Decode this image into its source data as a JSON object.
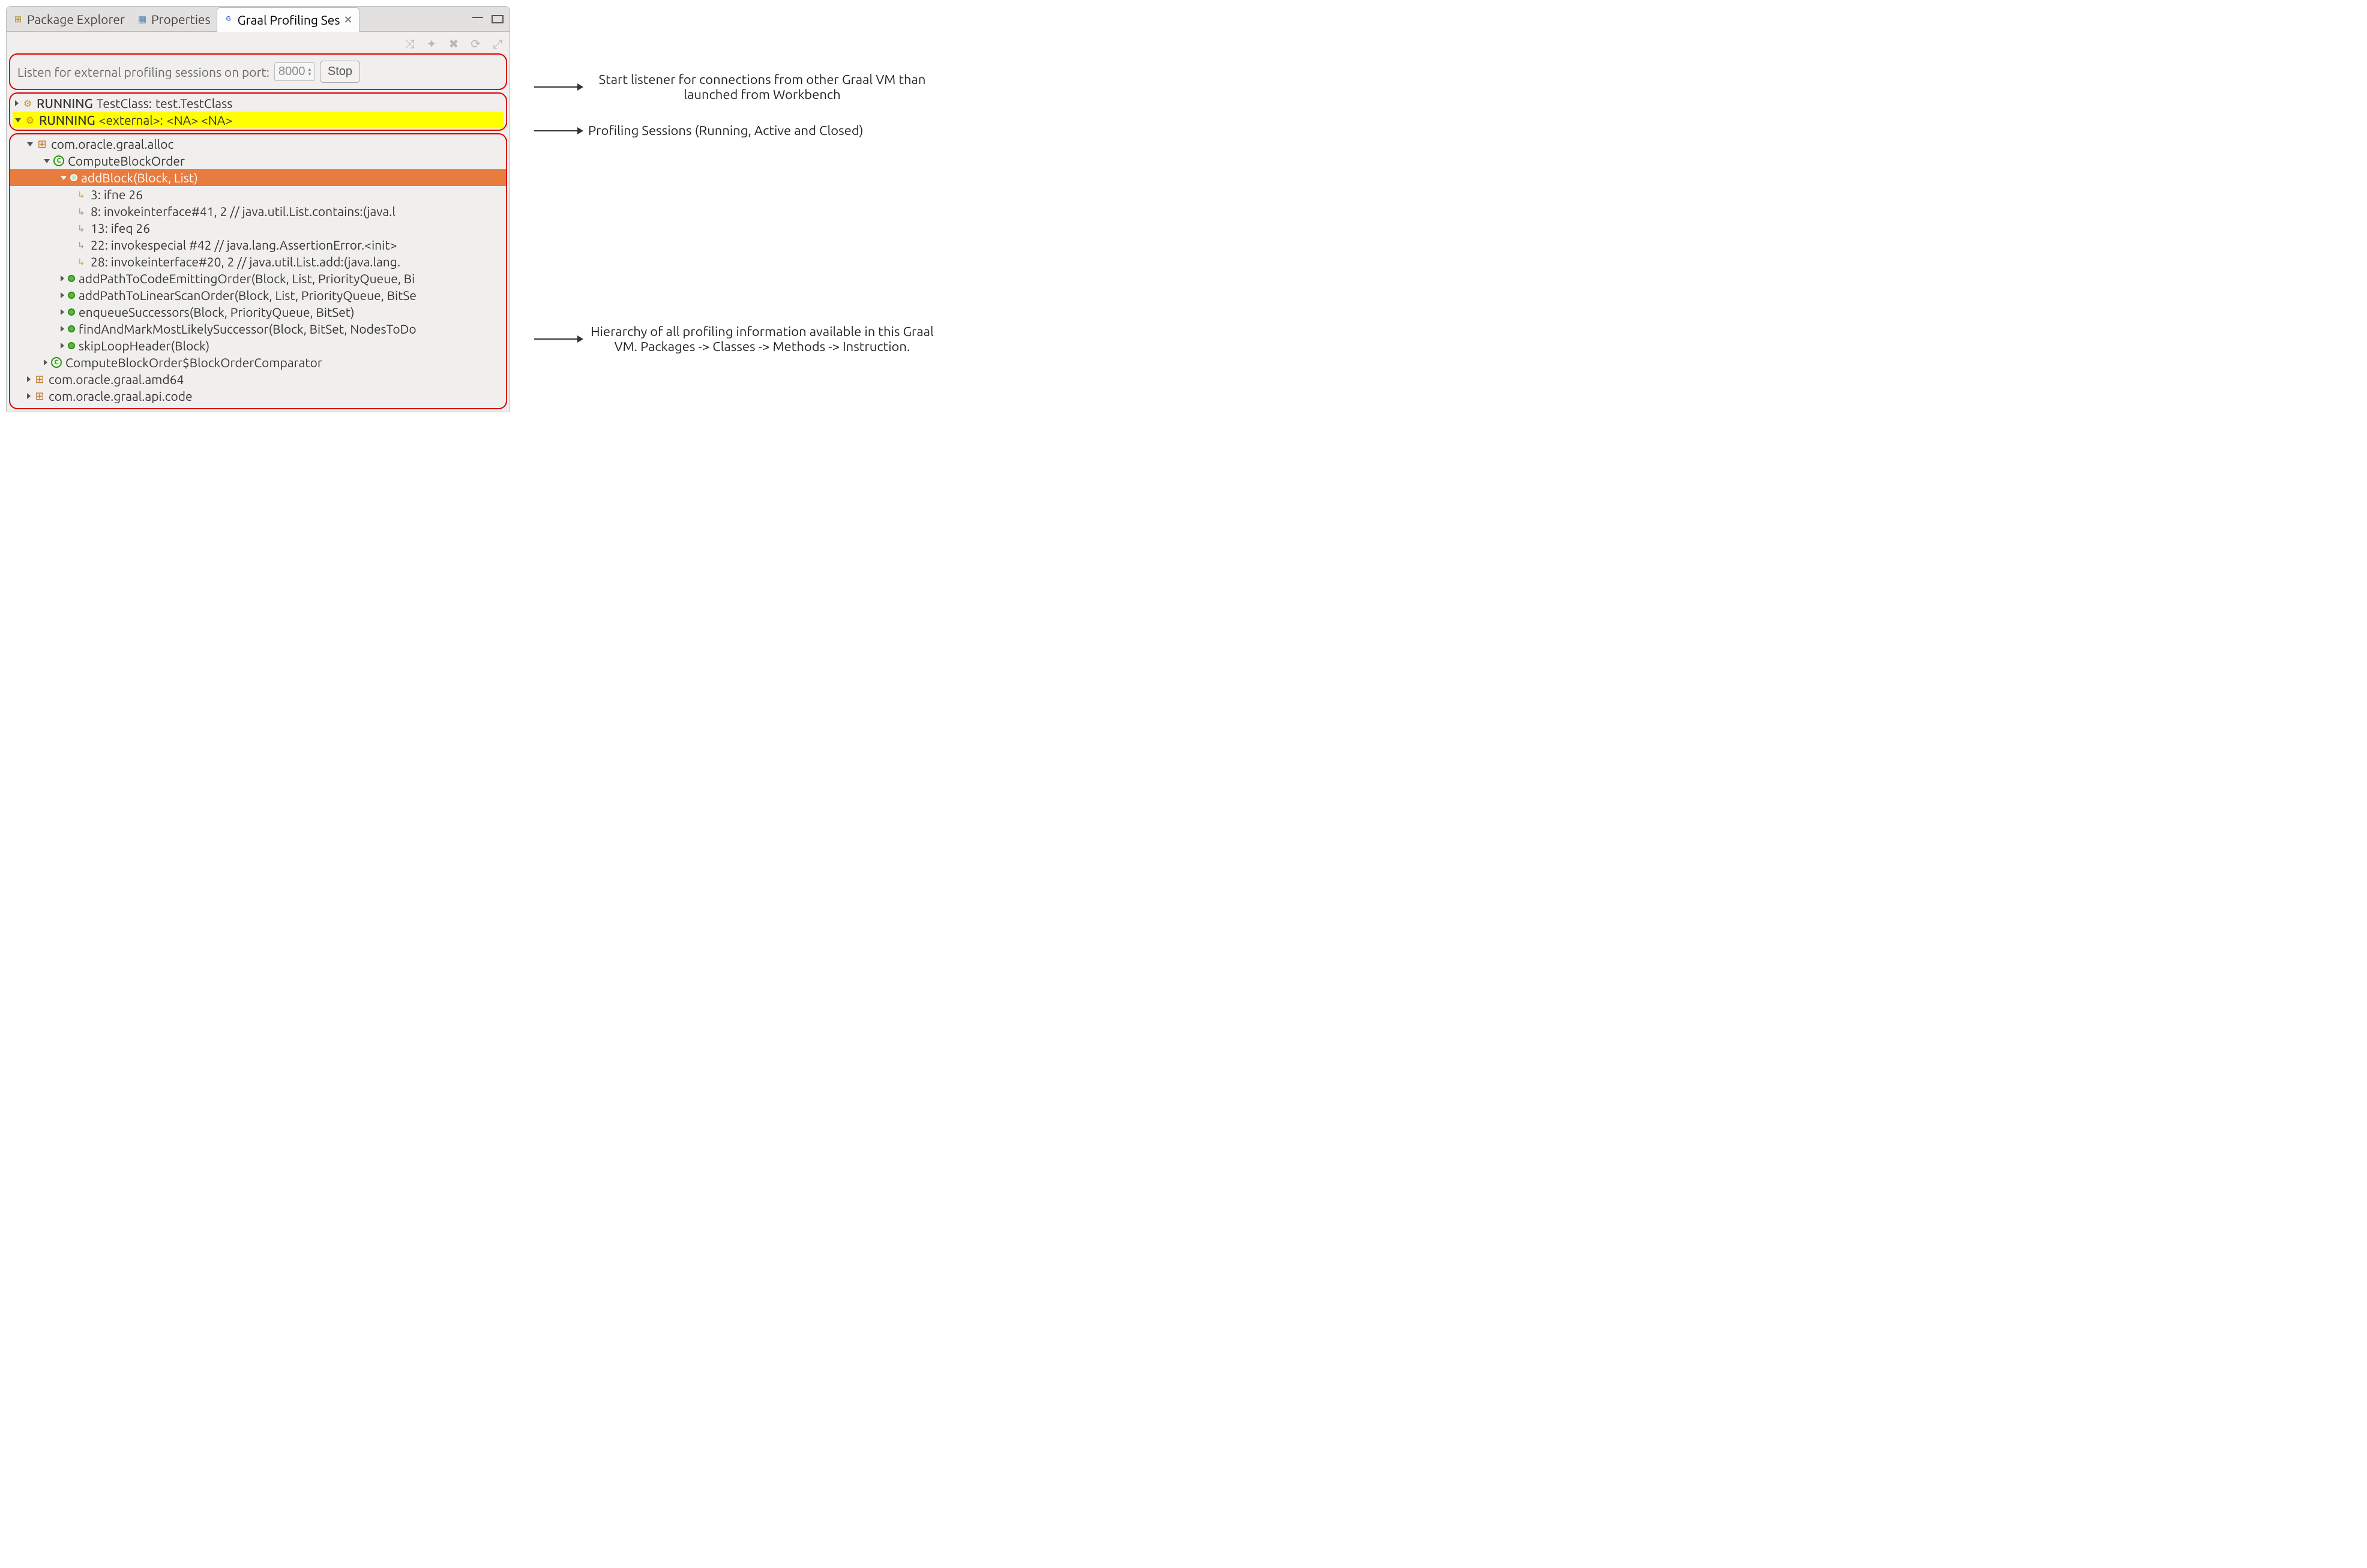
{
  "tabs": {
    "explorer": "Package Explorer",
    "properties": "Properties",
    "graal": "Graal Profiling Ses"
  },
  "toolbar_icons": [
    "route",
    "puzzle",
    "x",
    "refresh",
    "collapse"
  ],
  "portrow": {
    "label": "Listen for external profiling sessions on port:",
    "port": "8000",
    "stop": "Stop"
  },
  "sessions": [
    {
      "status": "RUNNING",
      "name": "TestClass:",
      "detail": "test.TestClass",
      "expanded": "right",
      "hl": false
    },
    {
      "status": "RUNNING",
      "name": "<external>:",
      "detail": "<NA> <NA>",
      "expanded": "down",
      "hl": true
    }
  ],
  "tree": {
    "pkg": "com.oracle.graal.alloc",
    "class": "ComputeBlockOrder",
    "sel_method": "addBlock(Block, List)",
    "instrs": [
      "3: ifne        26",
      " 8: invokeinterface#41, 2    // java.util.List.contains:(java.l",
      "13: ifeq        26",
      "22: invokespecial #42       // java.lang.AssertionError.<init>",
      "28: invokeinterface#20, 2    // java.util.List.add:(java.lang."
    ],
    "methods": [
      "addPathToCodeEmittingOrder(Block, List, PriorityQueue, Bi",
      "addPathToLinearScanOrder(Block, List, PriorityQueue, BitSe",
      "enqueueSuccessors(Block, PriorityQueue, BitSet)",
      "findAndMarkMostLikelySuccessor(Block, BitSet, NodesToDo",
      "skipLoopHeader(Block)"
    ],
    "class2": "ComputeBlockOrder$BlockOrderComparator",
    "pkg2": "com.oracle.graal.amd64",
    "pkg3": "com.oracle.graal.api.code"
  },
  "annotations": {
    "a1": "Start listener for connections from other Graal VM than launched from Workbench",
    "a2": "Profiling Sessions (Running, Active and Closed)",
    "a3": "Hierarchy of all profiling information available in this Graal VM. Packages -> Classes -> Methods -> Instruction."
  }
}
